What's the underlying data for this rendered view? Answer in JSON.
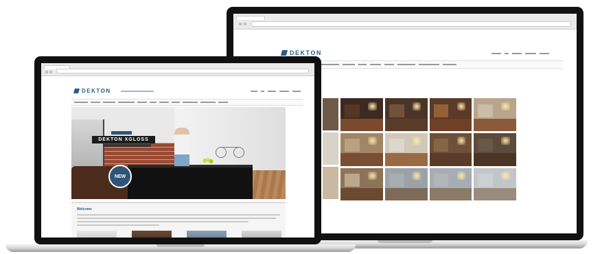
{
  "brand": {
    "name": "DEKTON",
    "accent": "#2b5c8a"
  },
  "left_site": {
    "hero_product": "DEKTON XGLOSS",
    "badge": "NEW",
    "section_title": "Welcome"
  },
  "colors": {
    "laptop_bezel": "#111111",
    "section_title": "#2b5c8a",
    "badge": "#2f5478"
  },
  "gallery_tiles": [
    {
      "wall": "#5b3a26",
      "floor": "#7b4a2c",
      "bg": "#3c2a22"
    },
    {
      "wall": "#7a5a3e",
      "floor": "#5a3b29",
      "bg": "#4b3427"
    },
    {
      "wall": "#a56a3a",
      "floor": "#6d4027",
      "bg": "#5a3a28"
    },
    {
      "wall": "#cfc2ae",
      "floor": "#8b5a3a",
      "bg": "#b8a58b"
    },
    {
      "wall": "#bfa888",
      "floor": "#7a4e33",
      "bg": "#a08566"
    },
    {
      "wall": "#e0dad0",
      "floor": "#9a6a45",
      "bg": "#d2c8b8"
    },
    {
      "wall": "#8a6a4c",
      "floor": "#5a3a28",
      "bg": "#6e5038"
    },
    {
      "wall": "#6c5a48",
      "floor": "#4a3424",
      "bg": "#5c4a3a"
    },
    {
      "wall": "#c8b49a",
      "floor": "#6a4a30",
      "bg": "#8d7358"
    },
    {
      "wall": "#aab0b4",
      "floor": "#7e6a58",
      "bg": "#9ca3a8"
    },
    {
      "wall": "#b4b8bc",
      "floor": "#8a7a68",
      "bg": "#a7adb2"
    },
    {
      "wall": "#d0d2d4",
      "floor": "#9a8c7c",
      "bg": "#c2c6ca"
    }
  ]
}
